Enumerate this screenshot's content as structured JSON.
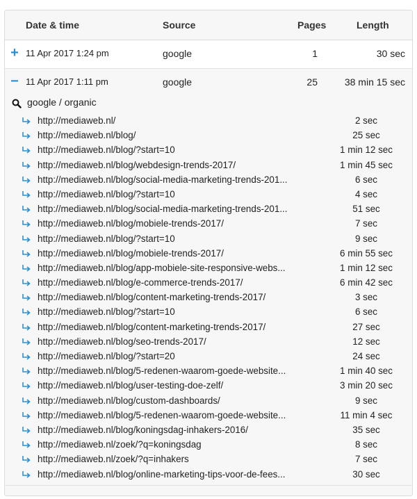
{
  "table": {
    "headers": {
      "date": "Date & time",
      "source": "Source",
      "pages": "Pages",
      "length": "Length"
    },
    "sessions": [
      {
        "toggle": "+",
        "date": "11 Apr 2017 1:24 pm",
        "source": "google",
        "pages": "1",
        "length": "30 sec"
      },
      {
        "toggle": "−",
        "date": "11 Apr 2017 1:11 pm",
        "source": "google",
        "pages": "25",
        "length": "38 min 15 sec"
      }
    ],
    "expanded": {
      "search_label": "google / organic",
      "pages": [
        {
          "url": "http://mediaweb.nl/",
          "duration": "2 sec"
        },
        {
          "url": "http://mediaweb.nl/blog/",
          "duration": "25 sec"
        },
        {
          "url": "http://mediaweb.nl/blog/?start=10",
          "duration": "1 min 12 sec"
        },
        {
          "url": "http://mediaweb.nl/blog/webdesign-trends-2017/",
          "duration": "1 min 45 sec"
        },
        {
          "url": "http://mediaweb.nl/blog/social-media-marketing-trends-201...",
          "duration": "6 sec"
        },
        {
          "url": "http://mediaweb.nl/blog/?start=10",
          "duration": "4 sec"
        },
        {
          "url": "http://mediaweb.nl/blog/social-media-marketing-trends-201...",
          "duration": "51 sec"
        },
        {
          "url": "http://mediaweb.nl/blog/mobiele-trends-2017/",
          "duration": "7 sec"
        },
        {
          "url": "http://mediaweb.nl/blog/?start=10",
          "duration": "9 sec"
        },
        {
          "url": "http://mediaweb.nl/blog/mobiele-trends-2017/",
          "duration": "6 min 55 sec"
        },
        {
          "url": "http://mediaweb.nl/blog/app-mobiele-site-responsive-webs...",
          "duration": "1 min 12 sec"
        },
        {
          "url": "http://mediaweb.nl/blog/e-commerce-trends-2017/",
          "duration": "6 min 42 sec"
        },
        {
          "url": "http://mediaweb.nl/blog/content-marketing-trends-2017/",
          "duration": "3 sec"
        },
        {
          "url": "http://mediaweb.nl/blog/?start=10",
          "duration": "6 sec"
        },
        {
          "url": "http://mediaweb.nl/blog/content-marketing-trends-2017/",
          "duration": "27 sec"
        },
        {
          "url": "http://mediaweb.nl/blog/seo-trends-2017/",
          "duration": "12 sec"
        },
        {
          "url": "http://mediaweb.nl/blog/?start=20",
          "duration": "24 sec"
        },
        {
          "url": "http://mediaweb.nl/blog/5-redenen-waarom-goede-website...",
          "duration": "1 min 40 sec"
        },
        {
          "url": "http://mediaweb.nl/blog/user-testing-doe-zelf/",
          "duration": "3 min 20 sec"
        },
        {
          "url": "http://mediaweb.nl/blog/custom-dashboards/",
          "duration": "9 sec"
        },
        {
          "url": "http://mediaweb.nl/blog/5-redenen-waarom-goede-website...",
          "duration": "11 min 4 sec"
        },
        {
          "url": "http://mediaweb.nl/blog/koningsdag-inhakers-2016/",
          "duration": "35 sec"
        },
        {
          "url": "http://mediaweb.nl/zoek/?q=koningsdag",
          "duration": "8 sec"
        },
        {
          "url": "http://mediaweb.nl/zoek/?q=inhakers",
          "duration": "7 sec"
        },
        {
          "url": "http://mediaweb.nl/blog/online-marketing-tips-voor-de-fees...",
          "duration": "30 sec"
        }
      ]
    }
  },
  "colors": {
    "accent": "#2c8fd3",
    "panel_bg": "#f7f7f7",
    "border": "#dcdcdc"
  },
  "icons": {
    "expand": "plus-icon",
    "collapse": "minus-icon",
    "search": "search-icon",
    "page": "return-arrow-icon"
  }
}
